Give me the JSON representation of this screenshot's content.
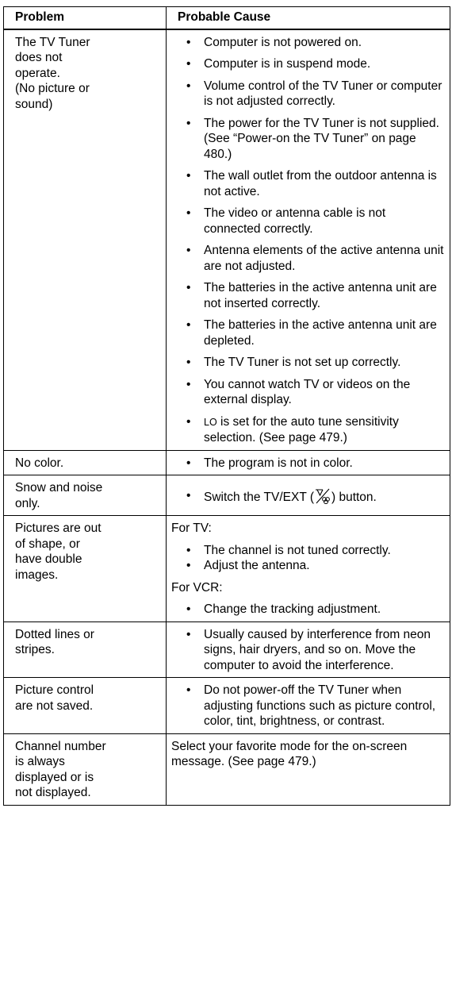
{
  "headers": {
    "problem": "Problem",
    "cause": "Probable Cause"
  },
  "rows": [
    {
      "problem": [
        "The TV Tuner",
        "does not",
        "operate.",
        "(No picture or",
        "sound)"
      ],
      "causes": [
        "Computer is not powered on.",
        "Computer is in suspend mode.",
        "Volume control of the TV Tuner or computer is not adjusted correctly.",
        "The power for the TV Tuner is not supplied.  (See “Power-on the TV Tuner” on page 480.)",
        "The wall outlet from the outdoor antenna is not active.",
        "The video or antenna cable is not connected correctly.",
        "Antenna elements of the active antenna unit are not adjusted.",
        "The batteries in the active antenna unit are not inserted correctly.",
        "The batteries in the active antenna unit are depleted.",
        "The TV Tuner is not set up correctly.",
        "You cannot watch TV or videos on the external display."
      ],
      "last_cause": {
        "keyword": "LO",
        "text": " is set for the auto tune sensitivity selection.  (See page 479.)"
      }
    },
    {
      "problem": [
        "No color."
      ],
      "causes": [
        "The program is not in color."
      ]
    },
    {
      "problem": [
        "Snow and noise",
        "only."
      ],
      "cause_before_icon": "Switch the TV/EXT (",
      "cause_icon": "tv-ext-icon",
      "cause_after_icon": ") button."
    },
    {
      "problem": [
        "Pictures are out",
        "of shape, or",
        "have double",
        "images."
      ],
      "group1_label": "For TV:",
      "group1_items": [
        "The channel is not tuned correctly.",
        "Adjust the antenna."
      ],
      "group2_label": "For VCR:",
      "group2_items": [
        "Change the tracking adjustment."
      ]
    },
    {
      "problem": [
        "Dotted lines or",
        "stripes."
      ],
      "causes": [
        "Usually caused by interference from neon signs, hair dryers, and so on.  Move the computer to avoid the interference."
      ]
    },
    {
      "problem": [
        "Picture control",
        "are not saved."
      ],
      "causes": [
        "Do not power-off the TV Tuner when adjusting functions such as picture control, color, tint, brightness, or contrast."
      ]
    },
    {
      "problem": [
        "Channel number",
        "is always",
        "displayed or is",
        "not displayed."
      ],
      "cause_text": "Select your favorite mode for the on-screen message.  (See page 479.)"
    }
  ]
}
